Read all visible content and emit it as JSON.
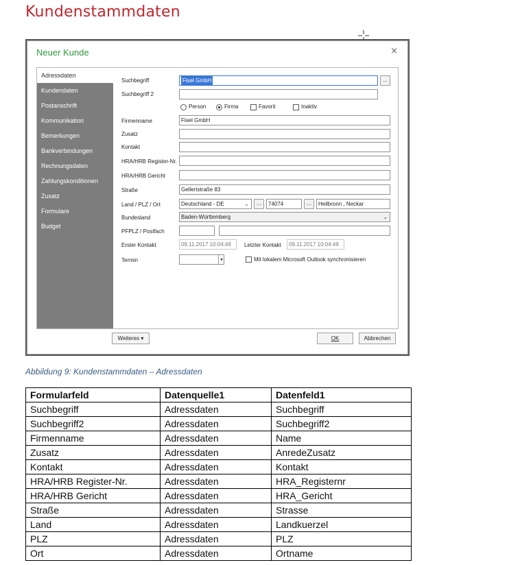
{
  "document": {
    "heading": "Kundenstammdaten",
    "caption": "Abbildung 9: Kundenstammdaten – Adressdaten"
  },
  "dialog": {
    "title": "Neuer Kunde",
    "close_glyph": "×",
    "nav": [
      {
        "label": "Adressdaten"
      },
      {
        "label": "Kundendaten"
      },
      {
        "label": "Postanschrift"
      },
      {
        "label": "Kommunikation"
      },
      {
        "label": "Bemerkungen"
      },
      {
        "label": "Bankverbindungen"
      },
      {
        "label": "Rechnungsdaten"
      },
      {
        "label": "Zahlungskonditionen"
      },
      {
        "label": "Zusatz"
      },
      {
        "label": "Formulare"
      },
      {
        "label": "Budget"
      }
    ],
    "active_nav": "Adressdaten",
    "form": {
      "suchbegriff_label": "Suchbegriff",
      "suchbegriff_value": "Fisel GmbH",
      "suchbegriff2_label": "Suchbegriff 2",
      "suchbegriff2_value": "",
      "options": [
        {
          "label": "Person",
          "kind": "radio",
          "checked": false
        },
        {
          "label": "Firma",
          "kind": "radio",
          "checked": true
        },
        {
          "label": "Favorit",
          "kind": "checkbox",
          "checked": false
        },
        {
          "label": "Inaktiv",
          "kind": "checkbox",
          "checked": false
        }
      ],
      "firmenname_label": "Firmenname",
      "firmenname_value": "Fisel GmbH",
      "zusatz_label": "Zusatz",
      "zusatz_value": "",
      "kontakt_label": "Kontakt",
      "kontakt_value": "",
      "hra_nr_label": "HRA/HRB Register-Nr.",
      "hra_nr_value": "",
      "hra_gericht_label": "HRA/HRB Gericht",
      "hra_gericht_value": "",
      "strasse_label": "Straße",
      "strasse_value": "Gellertstraße 83",
      "land_label": "Land / PLZ / Ort",
      "land_value": "Deutschland - DE",
      "plz_value": "74074",
      "ort_value": "Heilbronn , Neckar",
      "bundesland_label": "Bundesland",
      "bundesland_value": "Baden-Württemberg",
      "pfplz_label": "PFPLZ / Postfach",
      "pfplz_value": "",
      "postfach_value": "",
      "erster_kontakt_label": "Erster Kontakt",
      "erster_kontakt_value": "09.11.2017 10:04:49",
      "letzter_kontakt_label": "Letzter Kontakt",
      "letzter_kontakt_value": "09.11.2017 10:04:49",
      "termin_label": "Termin",
      "termin_value": "",
      "outlook_label": "Mit lokalem Microsoft Outlook synchronisieren",
      "outlook_checked": false,
      "dots": "..."
    },
    "buttons": {
      "weiteres": "Weiteres ▾",
      "ok": "OK",
      "abbrechen": "Abbrechen"
    }
  },
  "table": {
    "headers": [
      "Formularfeld",
      "Datenquelle1",
      "Datenfeld1"
    ],
    "rows": [
      [
        "Suchbegriff",
        "Adressdaten",
        "Suchbegriff"
      ],
      [
        "Suchbegriff2",
        "Adressdaten",
        "Suchbegriff2"
      ],
      [
        "Firmenname",
        "Adressdaten",
        "Name"
      ],
      [
        "Zusatz",
        "Adressdaten",
        "AnredeZusatz"
      ],
      [
        "Kontakt",
        "Adressdaten",
        "Kontakt"
      ],
      [
        "HRA/HRB Register-Nr.",
        "Adressdaten",
        "HRA_Registernr"
      ],
      [
        "HRA/HRB Gericht",
        "Adressdaten",
        "HRA_Gericht"
      ],
      [
        "Straße",
        "Adressdaten",
        "Strasse"
      ],
      [
        "Land",
        "Adressdaten",
        "Landkuerzel"
      ],
      [
        "PLZ",
        "Adressdaten",
        "PLZ"
      ],
      [
        "Ort",
        "Adressdaten",
        "Ortname"
      ]
    ]
  },
  "colors": {
    "heading": "#c0272d",
    "dialog_title": "#2f9a3f",
    "nav_background": "#7d7d7d",
    "selection": "#3a78d8",
    "caption": "#3b5b86"
  }
}
